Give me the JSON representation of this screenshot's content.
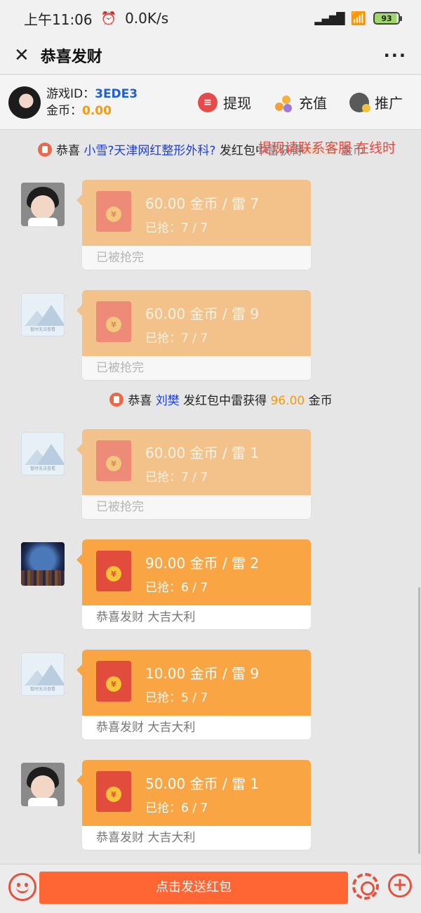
{
  "status_bar": {
    "time": "上午11:06",
    "speed": "0.0K/s",
    "battery": "93"
  },
  "nav": {
    "title": "恭喜发财"
  },
  "user": {
    "game_id_label": "游戏ID：",
    "game_id": "3EDE3",
    "coins_label": "金币：",
    "coins": "0.00",
    "actions": [
      "提现",
      "充值",
      "推广"
    ]
  },
  "banner": {
    "prefix": "恭喜",
    "nickname": "小雪?天津网红整形外科?",
    "mid": "发红包中雷获得",
    "amount": "96.00",
    "unit": "金币",
    "marquee": "提现请联系客服  在线时"
  },
  "notices": [
    {
      "prefix": "恭喜",
      "nickname": "刘樊",
      "mid": "发红包中雷获得",
      "amount": "96.00",
      "unit": "金币"
    }
  ],
  "packets": [
    {
      "amount": "60.00 金币 / 雷 7",
      "grabbed": "已抢：7 / 7",
      "footer": "已被抢完",
      "state": "done"
    },
    {
      "amount": "60.00 金币 / 雷 9",
      "grabbed": "已抢：7 / 7",
      "footer": "已被抢完",
      "state": "done"
    },
    {
      "amount": "60.00 金币 / 雷 1",
      "grabbed": "已抢：7 / 7",
      "footer": "已被抢完",
      "state": "done"
    },
    {
      "amount": "90.00 金币 / 雷 2",
      "grabbed": "已抢：6 / 7",
      "footer": "恭喜发财 大吉大利",
      "state": "live"
    },
    {
      "amount": "10.00 金币 / 雷 9",
      "grabbed": "已抢：5 / 7",
      "footer": "恭喜发财 大吉大利",
      "state": "live"
    },
    {
      "amount": "50.00 金币 / 雷 1",
      "grabbed": "已抢：6 / 7",
      "footer": "恭喜发财 大吉大利",
      "state": "live"
    }
  ],
  "avatar_placeholder_caption": "暂时无法查看",
  "coin_symbol": "¥",
  "bottom": {
    "send_label": "点击发送红包"
  },
  "colors": {
    "accent": "#ff6634",
    "packet_live": "#f9a543",
    "packet_done": "#f2c28a",
    "link": "#1e3fd0",
    "coin": "#f59a0c"
  }
}
